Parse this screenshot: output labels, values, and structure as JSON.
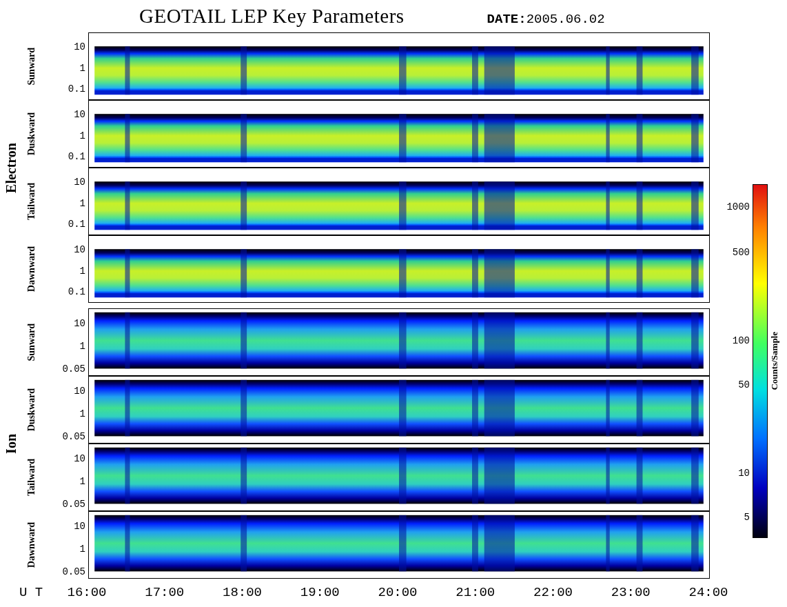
{
  "title": "GEOTAIL LEP Key Parameters",
  "date": "**DATE:**2005.06.02",
  "groups": [
    {
      "label": "Electron",
      "kind": "electron",
      "panels": [
        {
          "label": "Sunward",
          "ticks": [
            "10",
            "1",
            "0.1"
          ]
        },
        {
          "label": "Duskward",
          "ticks": [
            "10",
            "1",
            "0.1"
          ]
        },
        {
          "label": "Tailward",
          "ticks": [
            "10",
            "1",
            "0.1"
          ]
        },
        {
          "label": "Dawnward",
          "ticks": [
            "10",
            "1",
            "0.1"
          ]
        }
      ]
    },
    {
      "label": "Ion",
      "kind": "ion",
      "panels": [
        {
          "label": "Sunward",
          "ticks": [
            "10",
            "1",
            "0.05"
          ]
        },
        {
          "label": "Duskward",
          "ticks": [
            "10",
            "1",
            "0.05"
          ]
        },
        {
          "label": "Tailward",
          "ticks": [
            "10",
            "1",
            "0.05"
          ]
        },
        {
          "label": "Dawnward",
          "ticks": [
            "10",
            "1",
            "0.05"
          ]
        }
      ]
    }
  ],
  "x_axis": {
    "label": "U T",
    "ticks": [
      "16:00",
      "17:00",
      "18:00",
      "19:00",
      "20:00",
      "21:00",
      "22:00",
      "23:00",
      "24:00"
    ]
  },
  "colorbar": {
    "label": "Counts/Sample",
    "ticks": [
      "1000",
      "500",
      "100",
      "50",
      "10",
      "5"
    ]
  }
}
